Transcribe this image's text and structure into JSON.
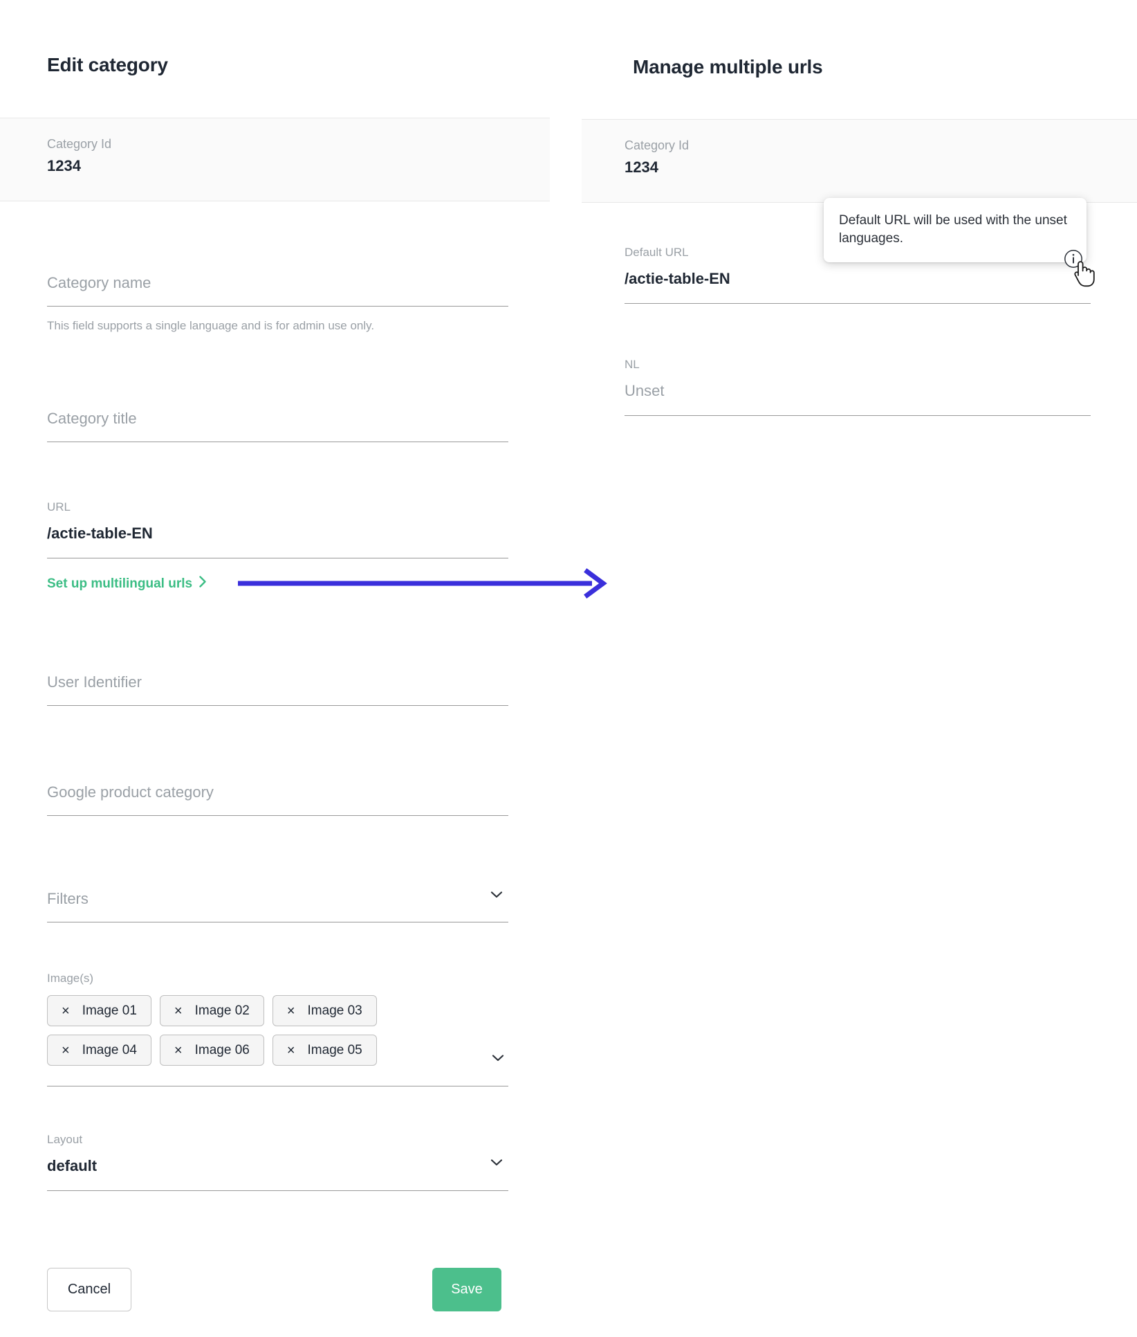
{
  "left_panel": {
    "title": "Edit category",
    "category_id": {
      "label": "Category Id",
      "value": "1234"
    },
    "fields": {
      "category_name": {
        "placeholder": "Category name",
        "help": "This field supports a single language and is for admin use only."
      },
      "category_title": {
        "placeholder": "Category title"
      },
      "url": {
        "label": "URL",
        "value": "/actie-table-EN"
      },
      "user_identifier": {
        "placeholder": "User Identifier"
      },
      "google_product_category": {
        "placeholder": "Google product category"
      },
      "filters": {
        "placeholder": "Filters"
      },
      "layout": {
        "label": "Layout",
        "value": "default"
      }
    },
    "multilingual_link": {
      "label": "Set up multilingual urls",
      "color": "#3bbd84"
    },
    "images": {
      "label": "Image(s)",
      "chips": [
        {
          "remove": "×",
          "label": "Image 01"
        },
        {
          "remove": "×",
          "label": "Image 02"
        },
        {
          "remove": "×",
          "label": "Image 03"
        },
        {
          "remove": "×",
          "label": "Image 04"
        },
        {
          "remove": "×",
          "label": "Image 06"
        },
        {
          "remove": "×",
          "label": "Image 05"
        }
      ]
    },
    "buttons": {
      "cancel": "Cancel",
      "save": "Save",
      "save_color": "#4cbf8c"
    }
  },
  "right_panel": {
    "title": "Manage multiple urls",
    "category_id": {
      "label": "Category Id",
      "value": "1234"
    },
    "default_url": {
      "label": "Default URL",
      "value": "/actie-table-EN"
    },
    "nl": {
      "label": "NL",
      "value": "Unset"
    },
    "tooltip": {
      "text": "Default URL will be used with the unset languages."
    }
  },
  "annotation": {
    "arrow_color": "#3a2fdb"
  }
}
